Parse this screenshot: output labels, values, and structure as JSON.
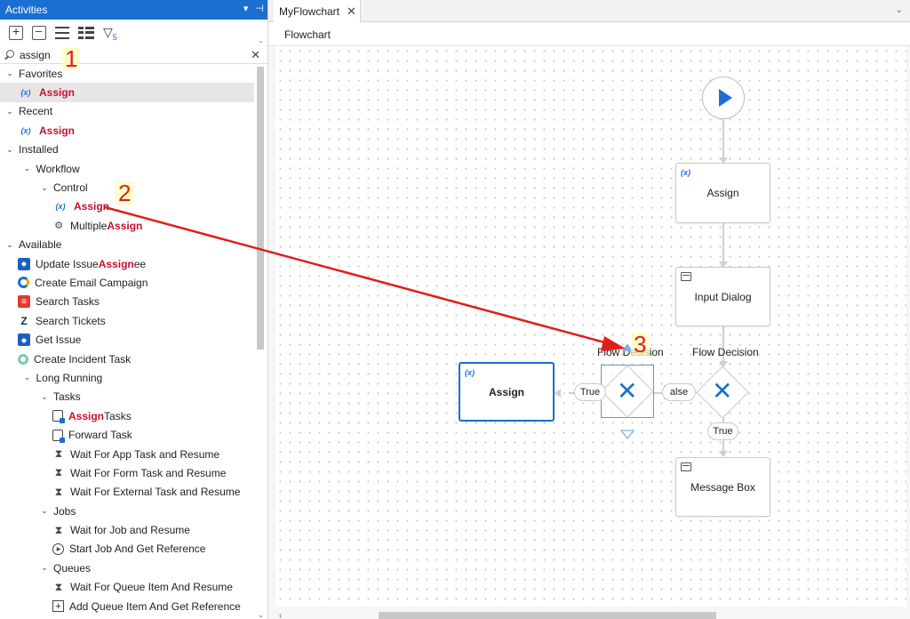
{
  "activities_panel": {
    "title": "Activities",
    "search_value": "assign",
    "tree": [
      {
        "kind": "group",
        "indent": 0,
        "caret": "v",
        "label": "Favorites"
      },
      {
        "kind": "item",
        "indent": 1,
        "icon": "var",
        "parts": [
          {
            "t": "Assign",
            "hl": true
          }
        ],
        "selected": true
      },
      {
        "kind": "group",
        "indent": 0,
        "caret": "v",
        "label": "Recent"
      },
      {
        "kind": "item",
        "indent": 1,
        "icon": "var",
        "parts": [
          {
            "t": "Assign",
            "hl": true
          }
        ]
      },
      {
        "kind": "group",
        "indent": 0,
        "caret": "v",
        "label": "Installed"
      },
      {
        "kind": "group",
        "indent": 1,
        "caret": "v",
        "label": "Workflow"
      },
      {
        "kind": "group",
        "indent": 2,
        "caret": "v",
        "label": "Control"
      },
      {
        "kind": "item",
        "indent": 3,
        "icon": "var",
        "parts": [
          {
            "t": "Assign",
            "hl": true
          }
        ]
      },
      {
        "kind": "item",
        "indent": 3,
        "icon": "multi",
        "parts": [
          {
            "t": "Multiple "
          },
          {
            "t": "Assign",
            "hl": true
          }
        ]
      },
      {
        "kind": "group",
        "indent": 0,
        "caret": "v",
        "label": "Available"
      },
      {
        "kind": "item",
        "indent": 1,
        "icon": "jira",
        "parts": [
          {
            "t": "Update Issue "
          },
          {
            "t": "Assign",
            "hl": true
          },
          {
            "t": "ee"
          }
        ]
      },
      {
        "kind": "item",
        "indent": 1,
        "icon": "camp",
        "parts": [
          {
            "t": "Create Email Campaign"
          }
        ]
      },
      {
        "kind": "item",
        "indent": 1,
        "icon": "todo",
        "parts": [
          {
            "t": "Search Tasks"
          }
        ]
      },
      {
        "kind": "item",
        "indent": 1,
        "icon": "zen",
        "parts": [
          {
            "t": "Search Tickets"
          }
        ]
      },
      {
        "kind": "item",
        "indent": 1,
        "icon": "jira",
        "parts": [
          {
            "t": "Get Issue"
          }
        ]
      },
      {
        "kind": "item",
        "indent": 1,
        "icon": "snow",
        "parts": [
          {
            "t": "Create Incident Task"
          }
        ]
      },
      {
        "kind": "group",
        "indent": 1,
        "caret": "v",
        "label": "Long Running"
      },
      {
        "kind": "group",
        "indent": 2,
        "caret": "v",
        "label": "Tasks"
      },
      {
        "kind": "item",
        "indent": 3,
        "icon": "task",
        "parts": [
          {
            "t": "Assign",
            "hl": true
          },
          {
            "t": " Tasks"
          }
        ]
      },
      {
        "kind": "item",
        "indent": 3,
        "icon": "task",
        "parts": [
          {
            "t": "Forward Task"
          }
        ]
      },
      {
        "kind": "item",
        "indent": 3,
        "icon": "hour",
        "parts": [
          {
            "t": "Wait For App Task and Resume"
          }
        ]
      },
      {
        "kind": "item",
        "indent": 3,
        "icon": "hour",
        "parts": [
          {
            "t": "Wait For Form Task and Resume"
          }
        ]
      },
      {
        "kind": "item",
        "indent": 3,
        "icon": "hour",
        "parts": [
          {
            "t": "Wait For External Task and Resume"
          }
        ]
      },
      {
        "kind": "group",
        "indent": 2,
        "caret": "v",
        "label": "Jobs"
      },
      {
        "kind": "item",
        "indent": 3,
        "icon": "hour",
        "parts": [
          {
            "t": "Wait for Job and Resume"
          }
        ]
      },
      {
        "kind": "item",
        "indent": 3,
        "icon": "play",
        "parts": [
          {
            "t": "Start Job And Get Reference"
          }
        ]
      },
      {
        "kind": "group",
        "indent": 2,
        "caret": "v",
        "label": "Queues"
      },
      {
        "kind": "item",
        "indent": 3,
        "icon": "hour",
        "parts": [
          {
            "t": "Wait For Queue Item And Resume"
          }
        ]
      },
      {
        "kind": "item",
        "indent": 3,
        "icon": "addq",
        "parts": [
          {
            "t": "Add Queue Item And Get Reference"
          }
        ]
      }
    ]
  },
  "document": {
    "tab_label": "MyFlowchart",
    "breadcrumb": "Flowchart"
  },
  "flowchart": {
    "assign_top": {
      "title": "Assign",
      "icon": "(x)"
    },
    "input_dialog": {
      "title": "Input Dialog"
    },
    "flow_decision_right": {
      "label": "Flow Decision"
    },
    "flow_decision_left": {
      "label": "Flow Decision"
    },
    "message_box": {
      "title": "Message Box"
    },
    "assign_new": {
      "title": "Assign",
      "icon": "(x)"
    },
    "true_left": "True",
    "false_label": "alse",
    "true_bottom": "True"
  },
  "annotations": {
    "marker_1": "1",
    "marker_2": "2",
    "marker_3": "3"
  },
  "colors": {
    "accent": "#1b6fd1",
    "highlight": "#c8102e",
    "annotation_red": "#e01e1e"
  }
}
